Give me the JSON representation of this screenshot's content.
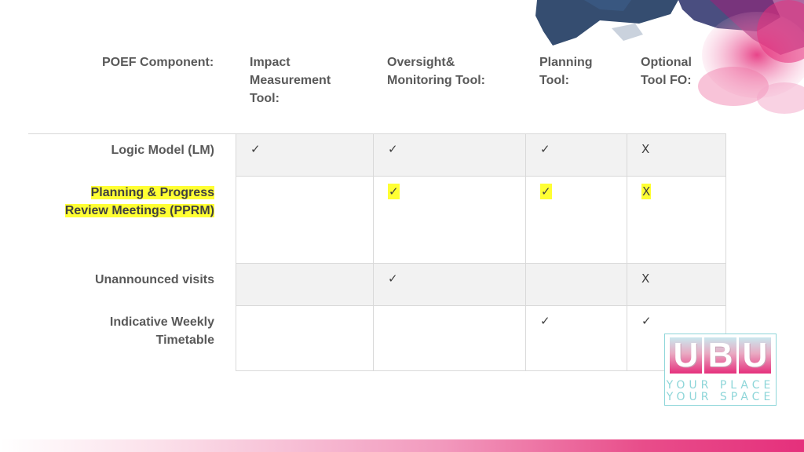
{
  "headers": {
    "component": "POEF Component:",
    "impact": [
      "Impact",
      "Measurement",
      "Tool:"
    ],
    "oversight": [
      "Oversight&",
      "Monitoring Tool:"
    ],
    "planning": [
      "Planning",
      "Tool:"
    ],
    "optional": [
      "Optional",
      "Tool FO:"
    ]
  },
  "rows": [
    {
      "label": [
        "Logic Model (LM)"
      ],
      "highlight": false,
      "cells": [
        "✓",
        "✓",
        "✓",
        "X"
      ]
    },
    {
      "label": [
        "Planning & Progress",
        "Review Meetings (PPRM)"
      ],
      "highlight": true,
      "cells": [
        "",
        "✓",
        "✓",
        "X"
      ]
    },
    {
      "label": [
        "Unannounced visits"
      ],
      "highlight": false,
      "cells": [
        "",
        "✓",
        "",
        "X"
      ]
    },
    {
      "label": [
        "Indicative Weekly",
        "Timetable"
      ],
      "highlight": false,
      "cells": [
        "",
        "",
        "✓",
        "✓"
      ]
    }
  ],
  "logo": {
    "letters": [
      "U",
      "B",
      "U"
    ],
    "line1": "YOUR PLACE",
    "line2": "YOUR SPACE"
  },
  "colors": {
    "highlight": "#ffff33",
    "accent_pink": "#e5307c",
    "accent_teal": "#8ed6d9",
    "navy": "#1f3a60"
  }
}
